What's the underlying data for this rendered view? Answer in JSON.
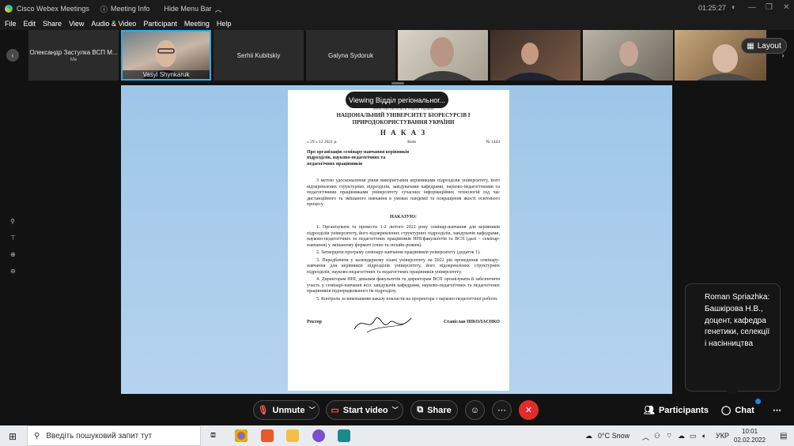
{
  "titlebar": {
    "app_title": "Cisco Webex Meetings",
    "meeting_info": "Meeting Info",
    "hide_menu_bar": "Hide Menu Bar",
    "timer": "01:25:27"
  },
  "menu": [
    "File",
    "Edit",
    "Share",
    "View",
    "Audio & Video",
    "Participant",
    "Meeting",
    "Help"
  ],
  "participants": [
    {
      "name": "Олександр Застулка ВСП М...",
      "sub": "Me"
    },
    {
      "name": "Vasyl Shynkaruk"
    },
    {
      "name": "Serhii Kubitskiy"
    },
    {
      "name": "Galyna Sydoruk"
    }
  ],
  "layout_label": "Layout",
  "viewing_label": "Viewing Відділ регіональног...",
  "document": {
    "header_small": "Міністерство освіти і науки України",
    "university_line1": "НАЦІОНАЛЬНИЙ УНІВЕРСИТЕТ БІОРЕСУРСІВ І",
    "university_line2": "ПРИРОДОКОРИСТУВАННЯ УКРАЇНИ",
    "order_title": "Н А К А З",
    "date": "« 29 »   12   2021 р.",
    "city": "Київ",
    "number": "№ 1443",
    "subject": "Про організацію семінару-навчання керівників підрозділів, науково-педагогічних та педагогічних працівників",
    "intro": "З метою удосконалення рівня використання керівниками підрозділів університету, його відокремлених структурних підрозділів, завідувачами кафедрами, науково-педагогічними та педагогічними працівниками університету сучасних інформаційних технологій під час дистанційного та змішаного навчання в умовах пандемії та покращення якості освітнього процесу",
    "order_word": "НАКАЗУЮ:",
    "items": [
      "1. Організувати та провести 1-2 лютого 2022 року семінар-навчання для керівників підрозділів університету, його відокремлених структурних підрозділів, завідувачів кафедрами, науково-педагогічних та педагогічних працівників ННІ/факультетів та ВСП (далі – семінар-навчання) у змішаному форматі (очно та онлайн-режим).",
      "2. Затвердити програму семінару-навчання працівників університету (додаток 1).",
      "3. Передбачити у календарному плані університету на 2022 рік проведення семінару-навчання для керівників підрозділів університету, його відокремлених структурних підрозділів, науково-педагогічних та педагогічних працівників університету.",
      "4. Директорам ННІ, деканам факультетів та директорам ВСП організувати й забезпечити участь у семінарі-навчанні всіх завідувачів кафедрами, науково-педагогічних та педагогічних працівників підпорядкованого їм підрозділу.",
      "5. Контроль за виконанням наказу покласти на проректора з науково-педагогічної роботи."
    ],
    "signer_title": "Ректор",
    "signer_name": "Станіслав НІКОЛАЄНКО"
  },
  "chat_popup": "Roman Spriazhka: Башкірова Н.В., доцент, кафедра генетики, селекції і насінництва",
  "controls": {
    "unmute": "Unmute",
    "start_video": "Start video",
    "share": "Share",
    "participants": "Participants",
    "chat": "Chat"
  },
  "taskbar": {
    "search_placeholder": "Введіть пошуковий запит тут",
    "weather": "0°C  Snow",
    "lang": "УКР",
    "time": "10:01",
    "date": "02.02.2022"
  }
}
